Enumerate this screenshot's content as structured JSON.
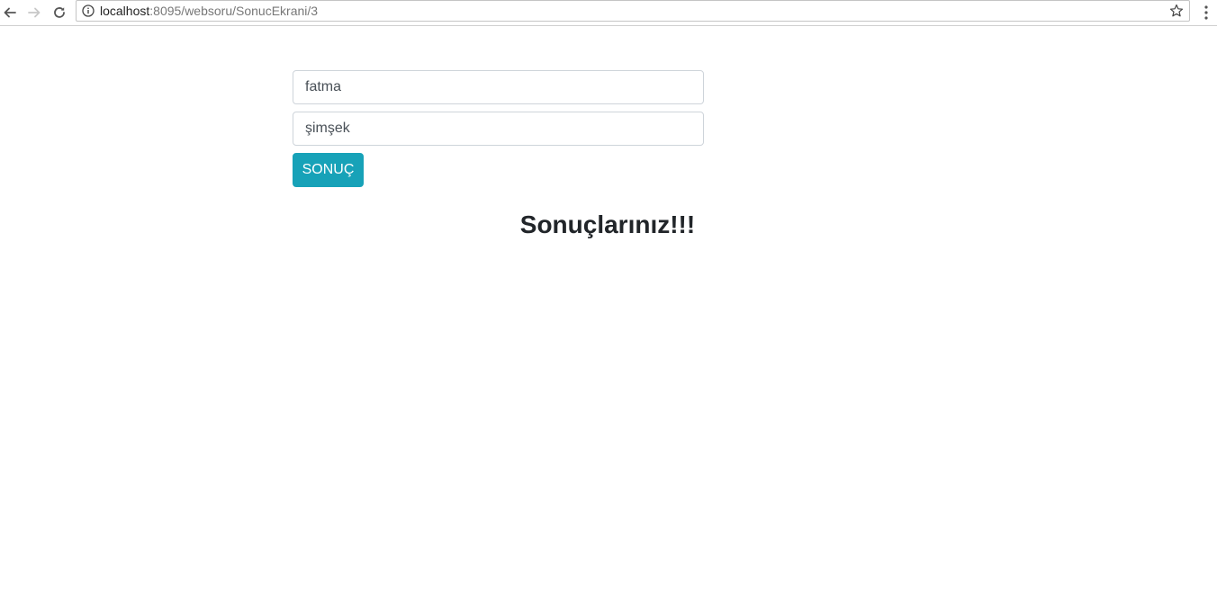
{
  "browser": {
    "url_host": "localhost",
    "url_path": ":8095/websoru/SonucEkrani/3",
    "icons": {
      "back": "arrow-left-icon",
      "forward": "arrow-right-icon",
      "reload": "reload-icon",
      "info": "info-icon",
      "bookmark": "star-icon",
      "menu": "kebab-menu-icon"
    }
  },
  "form": {
    "name_value": "fatma",
    "surname_value": "şimşek",
    "submit_label": "SONUÇ"
  },
  "results": {
    "heading": "Sonuçlarınız!!!"
  },
  "colors": {
    "button_bg": "#17a2b8",
    "button_text": "#ffffff",
    "heading_text": "#212529"
  }
}
